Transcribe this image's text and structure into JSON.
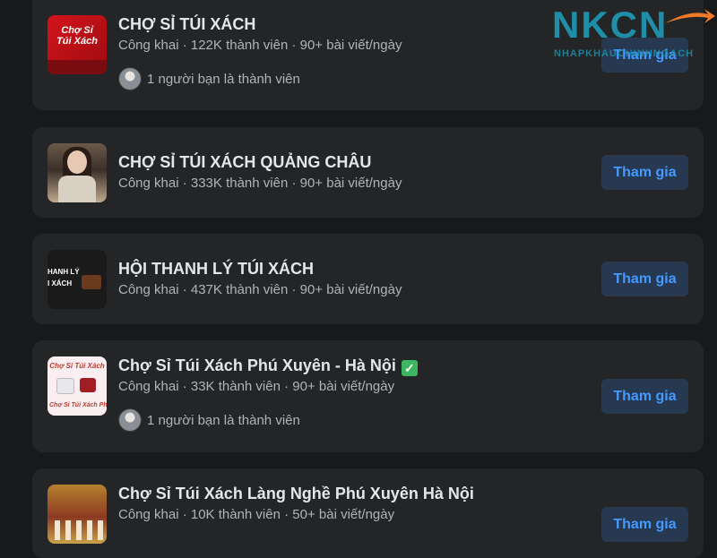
{
  "logo": {
    "text": "NKCN",
    "subtitle": "NHAPKHAUCHINHNGACH",
    "arrow_color": "#f07a2a"
  },
  "groups": [
    {
      "name": "CHỢ SỈ TÚI XÁCH",
      "meta": "Công khai · 122K thành viên · 90+ bài viết/ngày",
      "friends": "1 người bạn là thành viên",
      "join_label": "Tham gia",
      "thumb_text": [
        "Chợ Sỉ",
        "Túi Xách"
      ]
    },
    {
      "name": "CHỢ SỈ TÚI XÁCH QUẢNG CHÂU",
      "meta": "Công khai · 333K thành viên · 90+ bài viết/ngày",
      "join_label": "Tham gia"
    },
    {
      "name": "HỘI THANH LÝ TÚI XÁCH",
      "meta": "Công khai · 437K thành viên · 90+ bài viết/ngày",
      "join_label": "Tham gia",
      "thumb_text": [
        "HANH LÝ",
        "I XÁCH"
      ]
    },
    {
      "name": "Chợ Sỉ Túi Xách Phú Xuyên - Hà Nội",
      "verified": "✓",
      "meta": "Công khai · 33K thành viên · 90+ bài viết/ngày",
      "friends": "1 người bạn là thành viên",
      "join_label": "Tham gia",
      "thumb_text": [
        "Chợ Sỉ Túi Xách",
        "Chợ Sỉ Túi Xách Phú Xuy"
      ]
    },
    {
      "name": "Chợ Sỉ Túi Xách Làng Nghề Phú Xuyên Hà Nội",
      "meta": "Công khai · 10K thành viên · 50+ bài viết/ngày",
      "join_label": "Tham gia"
    }
  ],
  "colors": {
    "background": "#18191a",
    "card": "#242526",
    "join_bg": "#263951",
    "join_text": "#4599ff",
    "verified": "#3db561"
  }
}
